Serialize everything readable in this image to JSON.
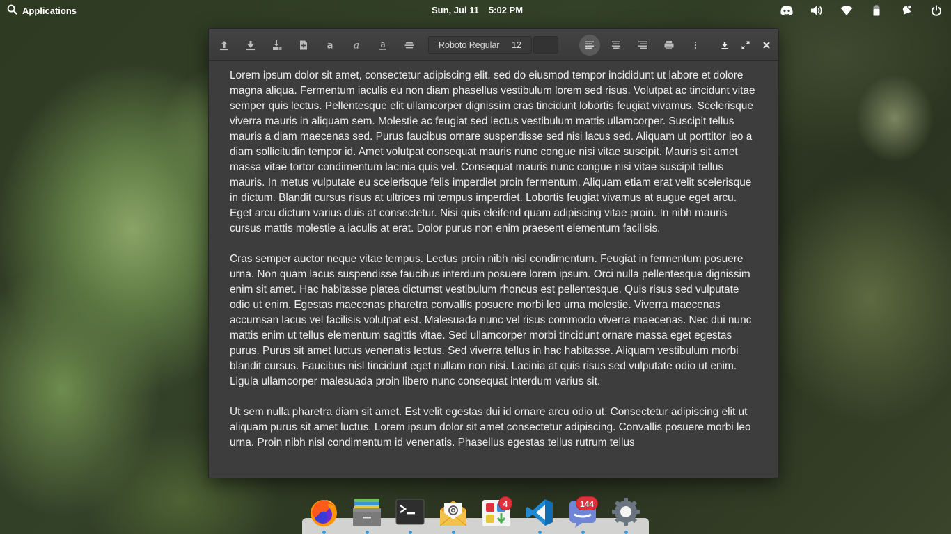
{
  "panel": {
    "applications_label": "Applications",
    "date": "Sun, Jul 11",
    "time": "5:02 PM"
  },
  "toolbar": {
    "font_name": "Roboto Regular",
    "font_size": "12"
  },
  "document": {
    "paragraphs": [
      "Lorem ipsum dolor sit amet, consectetur adipiscing elit, sed do eiusmod tempor incididunt ut labore et dolore magna aliqua. Fermentum iaculis eu non diam phasellus vestibulum lorem sed risus. Volutpat ac tincidunt vitae semper quis lectus. Pellentesque elit ullamcorper dignissim cras tincidunt lobortis feugiat vivamus. Scelerisque viverra mauris in aliquam sem. Molestie ac feugiat sed lectus vestibulum mattis ullamcorper. Suscipit tellus mauris a diam maecenas sed. Purus faucibus ornare suspendisse sed nisi lacus sed. Aliquam ut porttitor leo a diam sollicitudin tempor id. Amet volutpat consequat mauris nunc congue nisi vitae suscipit. Mauris sit amet massa vitae tortor condimentum lacinia quis vel. Consequat mauris nunc congue nisi vitae suscipit tellus mauris. In metus vulputate eu scelerisque felis imperdiet proin fermentum. Aliquam etiam erat velit scelerisque in dictum. Blandit cursus risus at ultrices mi tempus imperdiet. Lobortis feugiat vivamus at augue eget arcu. Eget arcu dictum varius duis at consectetur. Nisi quis eleifend quam adipiscing vitae proin. In nibh mauris cursus mattis molestie a iaculis at erat. Dolor purus non enim praesent elementum facilisis.",
      "Cras semper auctor neque vitae tempus. Lectus proin nibh nisl condimentum. Feugiat in fermentum posuere urna. Non quam lacus suspendisse faucibus interdum posuere lorem ipsum. Orci nulla pellentesque dignissim enim sit amet. Hac habitasse platea dictumst vestibulum rhoncus est pellentesque. Quis risus sed vulputate odio ut enim. Egestas maecenas pharetra convallis posuere morbi leo urna molestie. Viverra maecenas accumsan lacus vel facilisis volutpat est. Malesuada nunc vel risus commodo viverra maecenas. Nec dui nunc mattis enim ut tellus elementum sagittis vitae. Sed ullamcorper morbi tincidunt ornare massa eget egestas purus. Purus sit amet luctus venenatis lectus. Sed viverra tellus in hac habitasse. Aliquam vestibulum morbi blandit cursus. Faucibus nisl tincidunt eget nullam non nisi. Lacinia at quis risus sed vulputate odio ut enim. Ligula ullamcorper malesuada proin libero nunc consequat interdum varius sit.",
      "Ut sem nulla pharetra diam sit amet. Est velit egestas dui id ornare arcu odio ut. Consectetur adipiscing elit ut aliquam purus sit amet luctus. Lorem ipsum dolor sit amet consectetur adipiscing. Convallis posuere morbi leo urna. Proin nibh nisl condimentum id venenatis. Phasellus egestas tellus rutrum tellus"
    ]
  },
  "dock": {
    "appcenter_badge": "4",
    "mail_badge": "144"
  },
  "colors": {
    "accent": "#3a9ad9",
    "badge": "#e0313b",
    "window_bg": "#3d3d3d"
  }
}
